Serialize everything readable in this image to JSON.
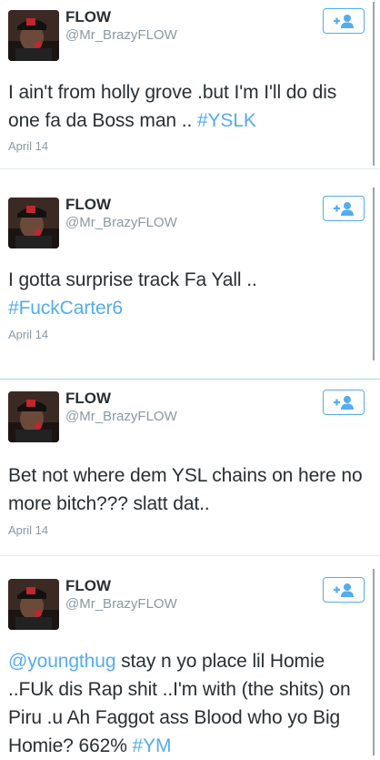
{
  "tweets": [
    {
      "name": "FLOW",
      "handle": "@Mr_BrazyFLOW",
      "text_plain": "I ain't from holly grove .but I'm I'll do dis one fa da Boss man .. ",
      "hashtag": "#YSLK",
      "date": "April 14"
    },
    {
      "name": "FLOW",
      "handle": "@Mr_BrazyFLOW",
      "text_plain": "I gotta surprise track Fa Yall .. ",
      "hashtag": "#FuckCarter6",
      "date": "April 14"
    },
    {
      "name": "FLOW",
      "handle": "@Mr_BrazyFLOW",
      "text_plain": "Bet not where dem YSL chains on here no more bitch??? slatt dat..",
      "date": "April 14"
    },
    {
      "name": "FLOW",
      "handle": "@Mr_BrazyFLOW",
      "mention": "@youngthug",
      "text_plain": " stay n yo place lil Homie ..FUk dis Rap shit ..I'm with (the shits) on Piru .u Ah  Faggot ass Blood who yo Big Homie? 662% ",
      "hashtag": "#YM"
    }
  ],
  "icons": {
    "follow": "add-user-icon"
  },
  "colors": {
    "accent": "#55acee",
    "text": "#292f33",
    "muted": "#8899a6"
  }
}
